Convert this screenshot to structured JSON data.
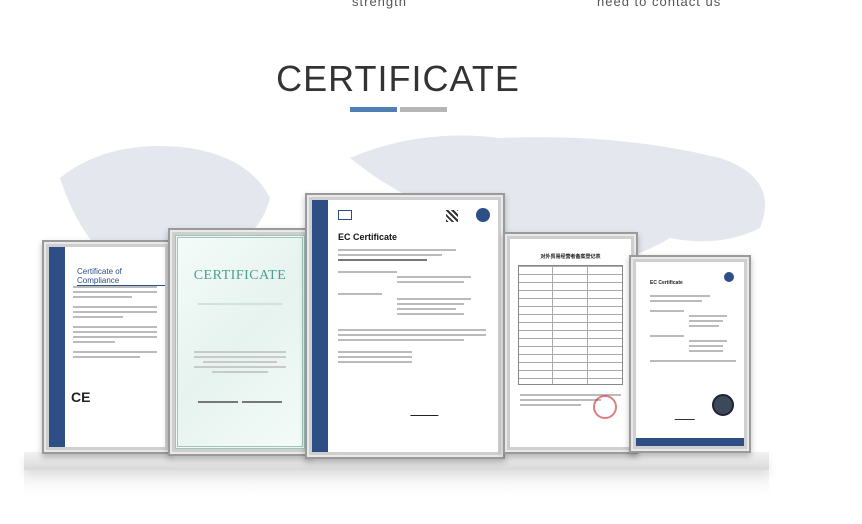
{
  "top_links": {
    "left": "strength",
    "right": "need to contact us"
  },
  "section": {
    "title": "CERTIFICATE",
    "accent_colors": [
      "#4f7fb4",
      "#b5b5b5"
    ]
  },
  "certificates": [
    {
      "title": "Certificate of Compliance",
      "mark": "CE"
    },
    {
      "title": "CERTIFICATE"
    },
    {
      "title": "EC Certificate"
    },
    {
      "title": "对外贸易经营者备案登记表"
    },
    {
      "title": "EC Certificate"
    }
  ]
}
